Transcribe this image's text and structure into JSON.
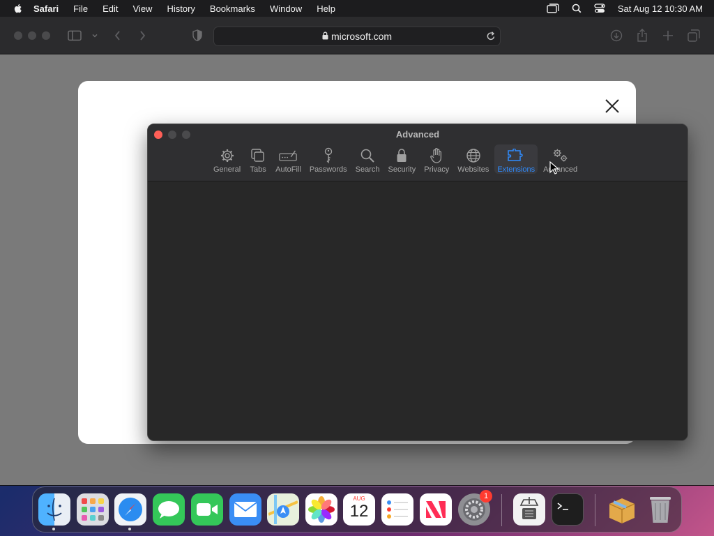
{
  "menubar": {
    "app_name": "Safari",
    "items": [
      "File",
      "Edit",
      "View",
      "History",
      "Bookmarks",
      "Window",
      "Help"
    ],
    "clock": "Sat Aug 12  10:30 AM"
  },
  "browser": {
    "url": "microsoft.com"
  },
  "prefs": {
    "title": "Advanced",
    "tabs": [
      {
        "label": "General",
        "icon": "gear-icon"
      },
      {
        "label": "Tabs",
        "icon": "tabs-icon"
      },
      {
        "label": "AutoFill",
        "icon": "autofill-icon"
      },
      {
        "label": "Passwords",
        "icon": "key-icon"
      },
      {
        "label": "Search",
        "icon": "search-icon"
      },
      {
        "label": "Security",
        "icon": "lock-icon"
      },
      {
        "label": "Privacy",
        "icon": "hand-icon"
      },
      {
        "label": "Websites",
        "icon": "globe-icon"
      },
      {
        "label": "Extensions",
        "icon": "puzzle-icon"
      },
      {
        "label": "Advanced",
        "icon": "gears-icon"
      }
    ],
    "active_tab": "Extensions",
    "accent_color": "#2f8cff"
  },
  "dock": {
    "calendar_month": "AUG",
    "calendar_day": "12",
    "settings_badge": "1",
    "apps": [
      "Finder",
      "Launchpad",
      "Safari",
      "Messages",
      "FaceTime",
      "Mail",
      "Maps",
      "Photos",
      "Calendar",
      "Reminders",
      "News",
      "System Settings",
      "Archive Utility",
      "Terminal",
      "Package",
      "Trash"
    ]
  }
}
